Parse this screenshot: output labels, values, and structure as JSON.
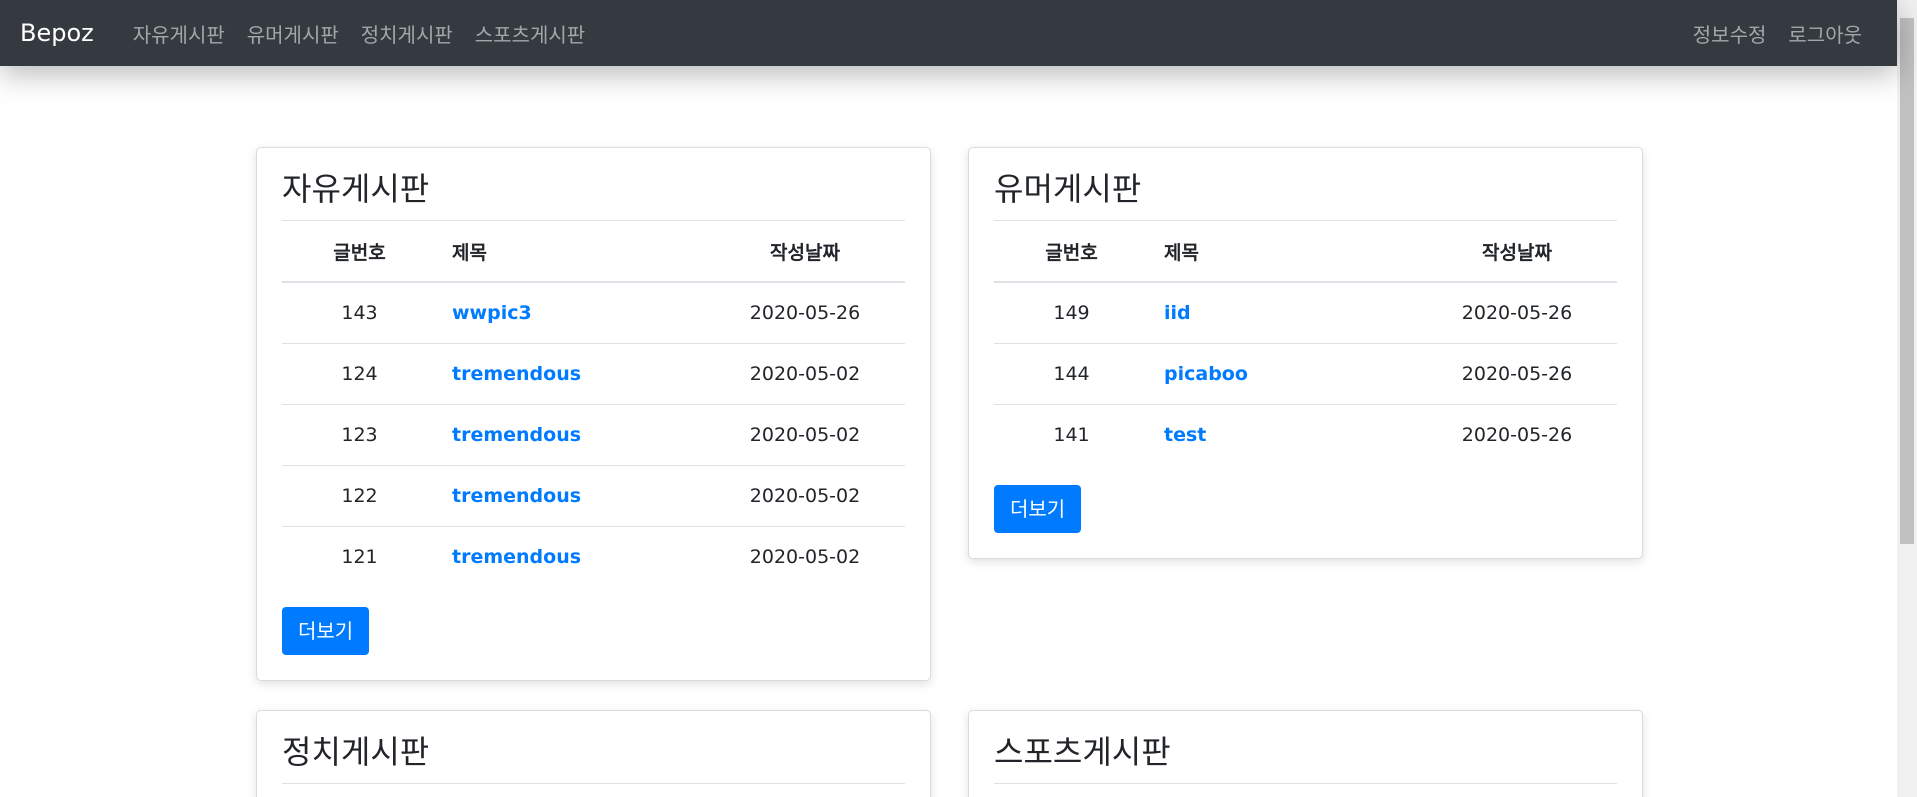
{
  "navbar": {
    "brand": "Bepoz",
    "left_links": [
      "자유게시판",
      "유머게시판",
      "정치게시판",
      "스포츠게시판"
    ],
    "right_links": [
      "정보수정",
      "로그아웃"
    ]
  },
  "table_headers": {
    "no": "글번호",
    "title": "제목",
    "date": "작성날짜"
  },
  "more_label": "더보기",
  "boards": [
    {
      "title": "자유게시판",
      "posts": [
        {
          "no": "143",
          "title": "wwpic3",
          "date": "2020-05-26"
        },
        {
          "no": "124",
          "title": "tremendous",
          "date": "2020-05-02"
        },
        {
          "no": "123",
          "title": "tremendous",
          "date": "2020-05-02"
        },
        {
          "no": "122",
          "title": "tremendous",
          "date": "2020-05-02"
        },
        {
          "no": "121",
          "title": "tremendous",
          "date": "2020-05-02"
        }
      ]
    },
    {
      "title": "유머게시판",
      "posts": [
        {
          "no": "149",
          "title": "iid",
          "date": "2020-05-26"
        },
        {
          "no": "144",
          "title": "picaboo",
          "date": "2020-05-26"
        },
        {
          "no": "141",
          "title": "test",
          "date": "2020-05-26"
        }
      ]
    },
    {
      "title": "정치게시판",
      "posts": []
    },
    {
      "title": "스포츠게시판",
      "posts": []
    }
  ],
  "colors": {
    "navbar_bg": "#343a40",
    "primary": "#007bff",
    "link": "#007bff"
  }
}
